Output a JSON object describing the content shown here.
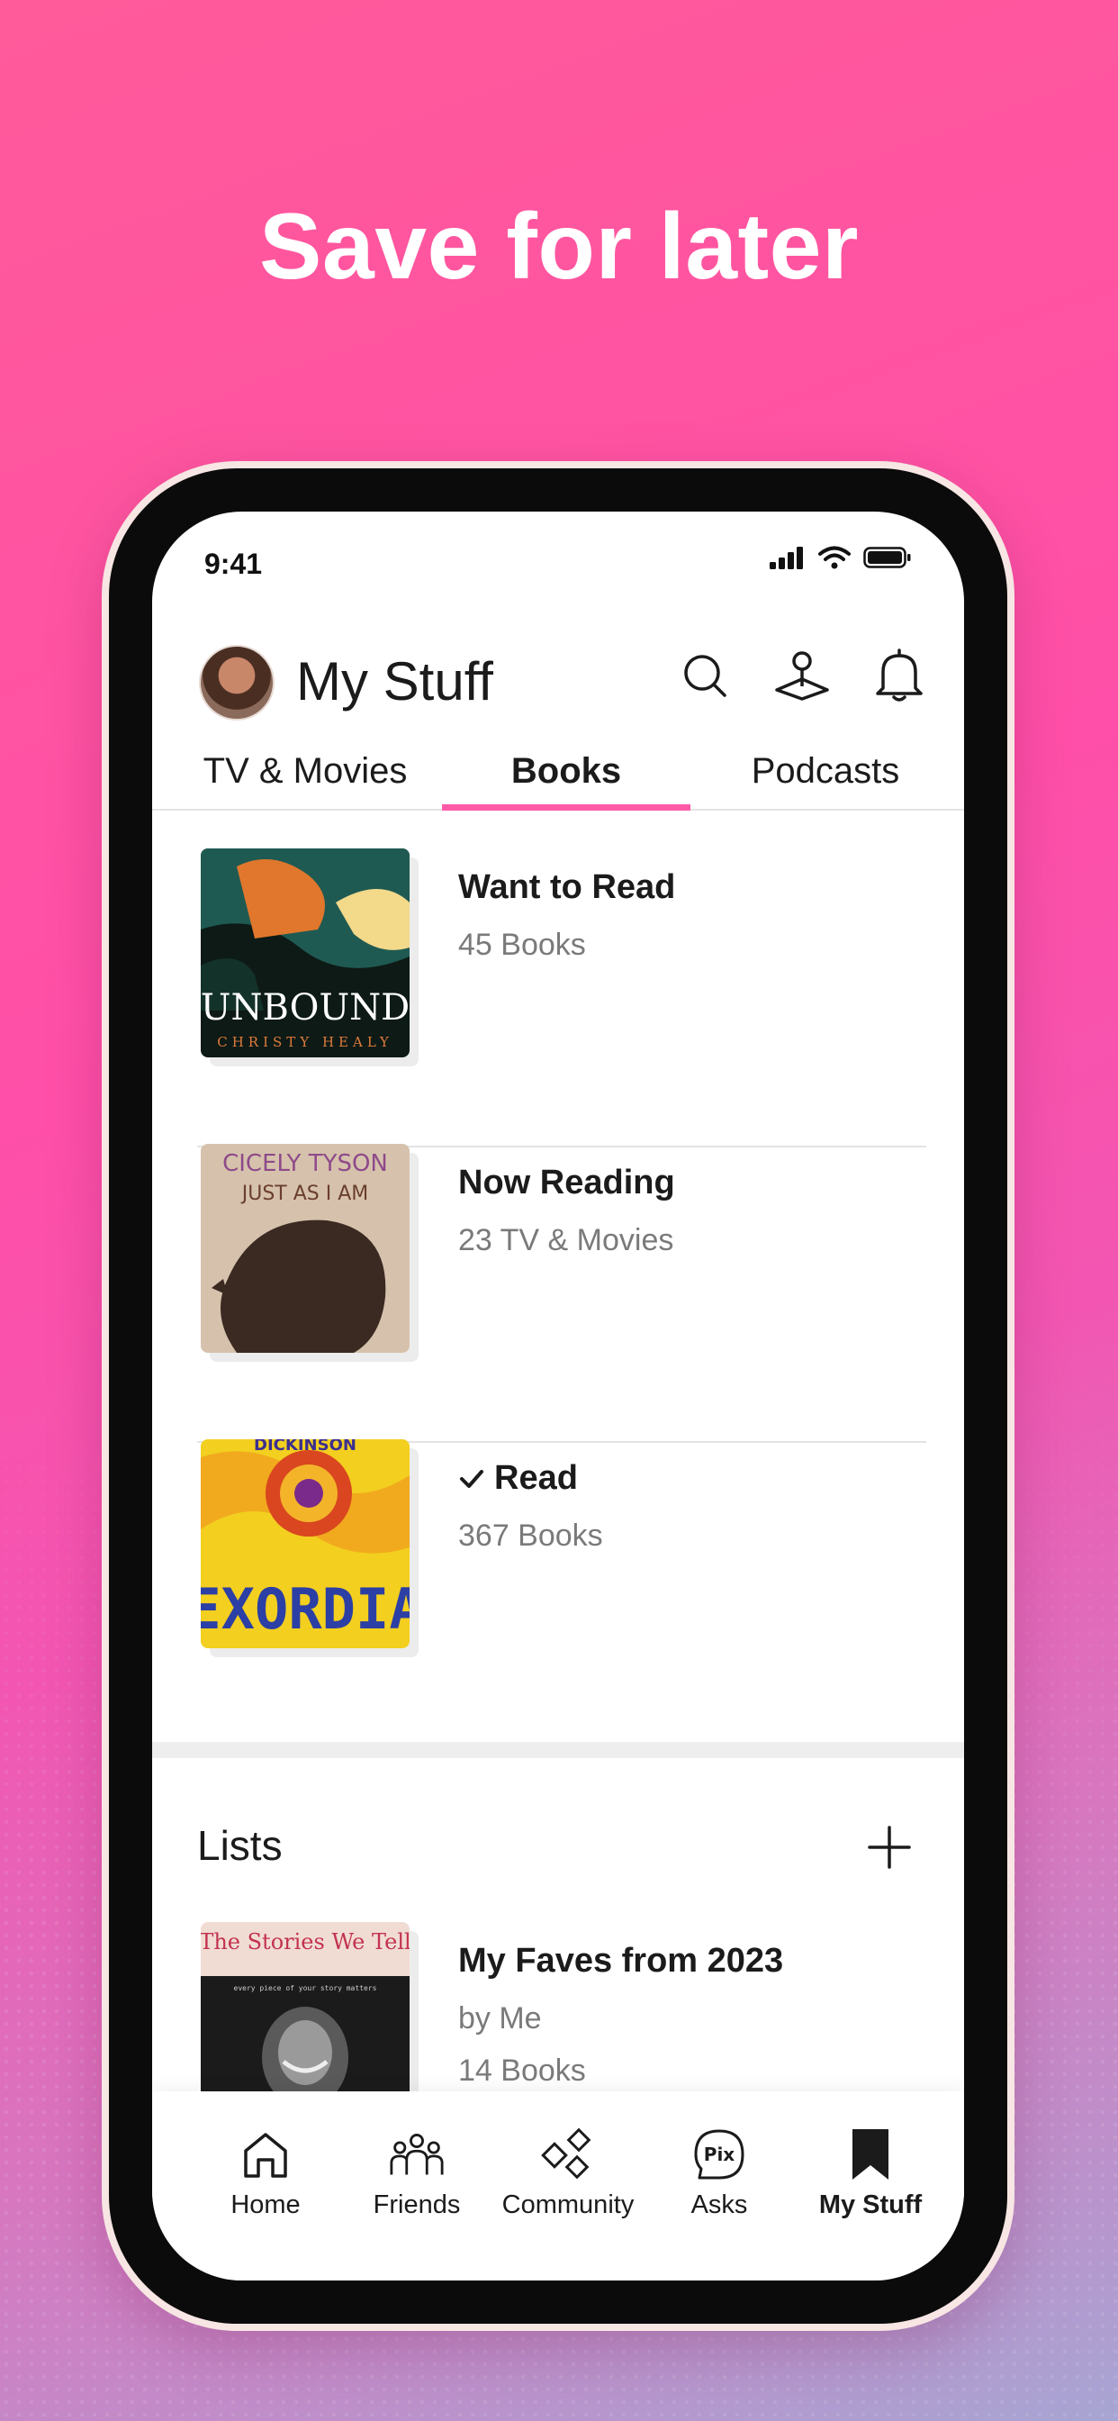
{
  "promo": {
    "headline": "Save for later"
  },
  "status_bar": {
    "time": "9:41"
  },
  "header": {
    "title": "My Stuff"
  },
  "tabs": [
    {
      "label": "TV & Movies",
      "active": false
    },
    {
      "label": "Books",
      "active": true
    },
    {
      "label": "Podcasts",
      "active": false
    }
  ],
  "shelves": [
    {
      "name": "Want to Read",
      "count": "45 Books",
      "checked": false,
      "cover": {
        "title": "UNBOUND",
        "author": "CHRISTY HEALY"
      }
    },
    {
      "name": "Now Reading",
      "count": "23 TV & Movies",
      "checked": false,
      "cover": {
        "title": "JUST AS I AM",
        "author": "CICELY TYSON"
      }
    },
    {
      "name": "Read",
      "count": "367 Books",
      "checked": true,
      "cover": {
        "title": "EXORDIA",
        "author": "DICKINSON"
      }
    }
  ],
  "lists": {
    "title": "Lists",
    "items": [
      {
        "name": "My Faves from 2023",
        "author": "by Me",
        "count": "14 Books",
        "cover": {
          "title": "The Stories We Tell",
          "tagline": "every piece of your story matters"
        }
      }
    ]
  },
  "bottom_nav": [
    {
      "label": "Home",
      "icon": "home-icon",
      "active": false
    },
    {
      "label": "Friends",
      "icon": "friends-icon",
      "active": false
    },
    {
      "label": "Community",
      "icon": "community-icon",
      "active": false
    },
    {
      "label": "Asks",
      "icon": "pix-icon",
      "active": false
    },
    {
      "label": "My Stuff",
      "icon": "bookmark-icon",
      "active": true
    }
  ],
  "colors": {
    "accent": "#ff5aa8",
    "background_top": "#ff5a9a",
    "background_bottom": "#a7a5d3"
  }
}
